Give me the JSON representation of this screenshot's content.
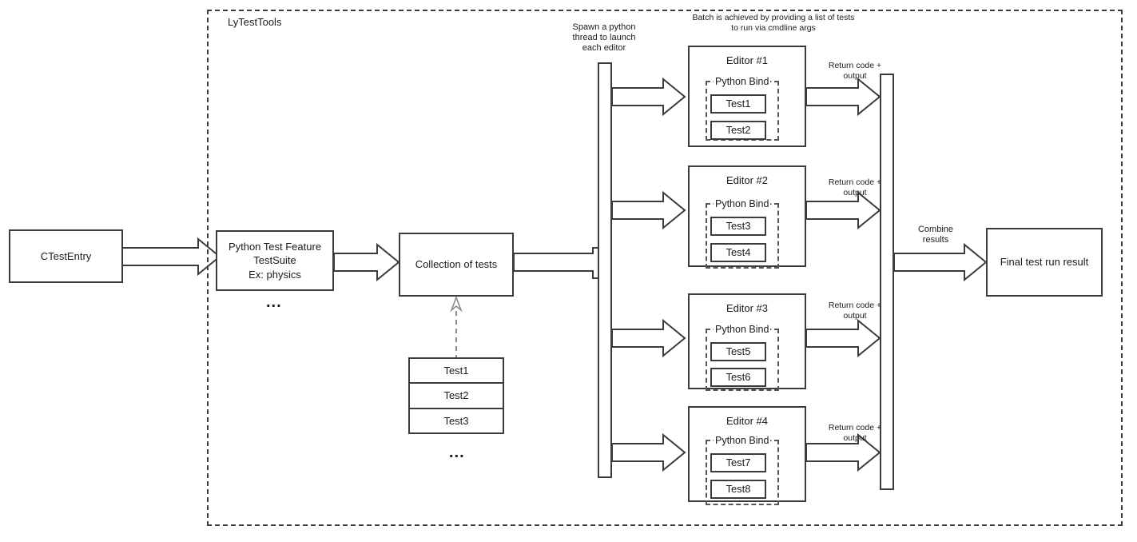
{
  "diagram": {
    "container_label": "LyTestTools",
    "annotations": {
      "spawn_thread": "Spawn a python\nthread to launch\neach editor",
      "batch": "Batch is achieved by providing a list of tests\nto run via cmdline args",
      "combine_results": "Combine\nresults",
      "return_code": "Return code +\noutput"
    },
    "ellipsis": "...",
    "nodes": {
      "ctest_entry": "CTestEntry",
      "python_test_feature": "Python Test Feature\nTestSuite\nEx: physics",
      "collection_of_tests": "Collection of tests",
      "final_result": "Final test run result"
    },
    "test_stack": [
      "Test1",
      "Test2",
      "Test3"
    ],
    "editors": [
      {
        "title": "Editor #1",
        "bind_label": "Python Bind",
        "tests": [
          "Test1",
          "Test2"
        ],
        "return_label": "Return code +\noutput"
      },
      {
        "title": "Editor #2",
        "bind_label": "Python Bind",
        "tests": [
          "Test3",
          "Test4"
        ],
        "return_label": "Return code +\noutput"
      },
      {
        "title": "Editor #3",
        "bind_label": "Python Bind",
        "tests": [
          "Test5",
          "Test6"
        ],
        "return_label": "Return code +\noutput"
      },
      {
        "title": "Editor #4",
        "bind_label": "Python Bind",
        "tests": [
          "Test7",
          "Test8"
        ],
        "return_label": "Return code +\noutput"
      }
    ],
    "colors": {
      "stroke": "#3b3b3b",
      "dashed_stroke": "#555555",
      "text": "#1b1b1b",
      "background": "#ffffff",
      "dependency_arrow": "#8a8a8a"
    }
  }
}
